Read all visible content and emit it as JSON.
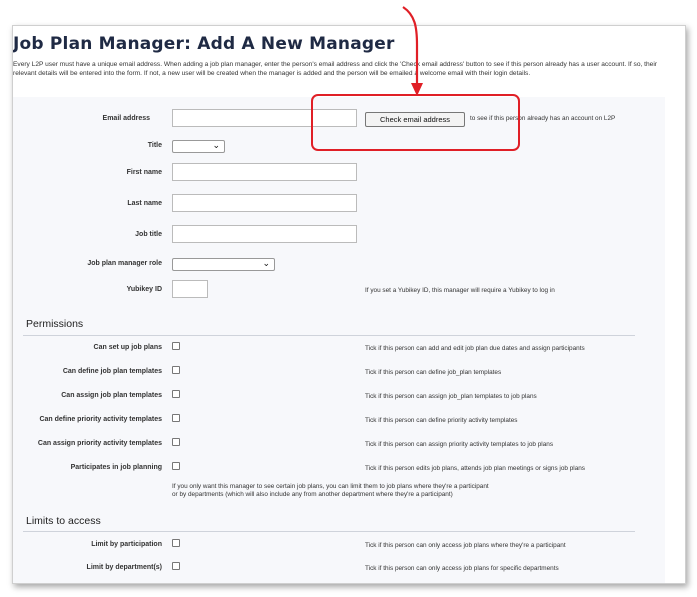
{
  "page": {
    "title": "Job Plan Manager: Add A New Manager",
    "intro": "Every L2P user must have a unique email address. When adding a job plan manager, enter the person's email address and click the 'Check email address' button to see if this person already has a user account. If so, their relevant details will be entered into the form. If not, a new user will be created when the manager is added and the person will be emailed a welcome email with their login details."
  },
  "form": {
    "email_label": "Email address",
    "email_value": "",
    "check_button": "Check email address",
    "check_hint": "to see if this person already has an account on L2P",
    "title_label": "Title",
    "title_value": "",
    "first_name_label": "First name",
    "last_name_label": "Last name",
    "job_title_label": "Job title",
    "role_label": "Job plan manager role",
    "role_value": "",
    "yubikey_label": "Yubikey ID",
    "yubikey_hint": "If you set a Yubikey ID, this manager will require a Yubikey to log in"
  },
  "permissions": {
    "heading": "Permissions",
    "items": [
      {
        "label": "Can set up job plans",
        "hint": "Tick if this person can add and edit job plan due dates and assign participants"
      },
      {
        "label": "Can define job plan templates",
        "hint": "Tick if this person can define job_plan templates"
      },
      {
        "label": "Can assign job plan templates",
        "hint": "Tick if this person can assign job_plan templates to job plans"
      },
      {
        "label": "Can define priority activity templates",
        "hint": "Tick if this person can define priority activity templates"
      },
      {
        "label": "Can assign priority activity templates",
        "hint": "Tick if this person can assign priority activity templates to job plans"
      },
      {
        "label": "Participates in job planning",
        "hint": "Tick if this person edits job plans, attends job plan meetings or signs job plans"
      }
    ],
    "note_line1": "If you only want this manager to see certain job plans, you can limit them to job plans where they're a participant",
    "note_line2": "or by departments (which will also include any from another department where they're a participant)"
  },
  "limits": {
    "heading": "Limits to access",
    "items": [
      {
        "label": "Limit by participation",
        "hint": "Tick if this person can only access job plans where they're a participant"
      },
      {
        "label": "Limit by department(s)",
        "hint": "Tick if this person can only access job plans for specific departments"
      }
    ]
  },
  "icons": {
    "select_chevron": "chevron-down-icon",
    "callout_arrow": "arrow-down-icon"
  },
  "colors": {
    "annotation": "#e01f26",
    "title": "#1f2a44",
    "panel": "#f7f8fb"
  }
}
